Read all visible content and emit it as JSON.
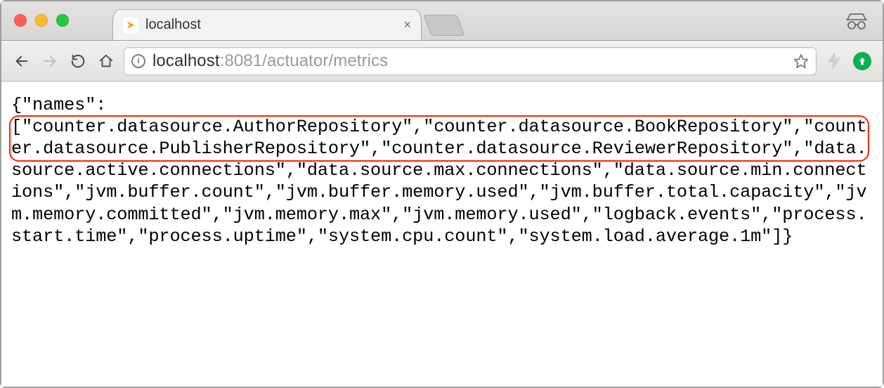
{
  "window": {
    "tab_title": "localhost",
    "favicon_glyph": "➤"
  },
  "address_bar": {
    "host": "localhost",
    "port_and_path": ":8081/actuator/metrics",
    "info_glyph": "i"
  },
  "json_response": {
    "names": [
      "counter.datasource.AuthorRepository",
      "counter.datasource.BookRepository",
      "counter.datasource.PublisherRepository",
      "counter.datasource.ReviewerRepository",
      "data.source.active.connections",
      "data.source.max.connections",
      "data.source.min.connections",
      "jvm.buffer.count",
      "jvm.buffer.memory.used",
      "jvm.buffer.total.capacity",
      "jvm.memory.committed",
      "jvm.memory.max",
      "jvm.memory.used",
      "logback.events",
      "process.start.time",
      "process.uptime",
      "system.cpu.count",
      "system.load.average.1m"
    ]
  },
  "annotation": {
    "highlighted_count": 4
  }
}
